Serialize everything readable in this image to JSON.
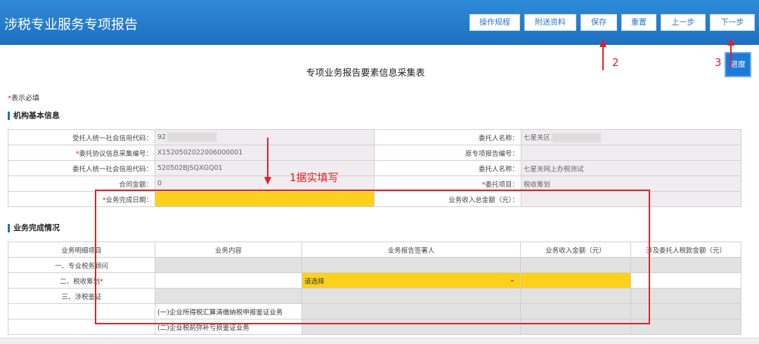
{
  "app": {
    "title": "涉税专业服务专项报告"
  },
  "toolbar": {
    "buttons": [
      "操作规程",
      "附送资料",
      "保存",
      "重置",
      "上一步",
      "下一步"
    ]
  },
  "progress_label": "进度",
  "page_title": "专项业务报告要素信息采集表",
  "required_note": {
    "star": "*",
    "text": "表示必填"
  },
  "sections": {
    "basic": "机构基本信息",
    "completion": "业务完成情况"
  },
  "basic_info": {
    "rows": [
      {
        "l1": "受托人统一社会信用代码：",
        "v1": "92",
        "l2": "委托人名称：",
        "v2": "七星关区"
      },
      {
        "l1_star": "*",
        "l1": "委托协议信息采集编号：",
        "v1": "X1520502022006000001",
        "l2": "原专项报告编号：",
        "v2": ""
      },
      {
        "l1": "委托人统一社会信用代码：",
        "v1": "520502BJSQXGQ01",
        "l2": "委托人名称：",
        "v2": "七星关网上办税测试"
      },
      {
        "l1": "合同金额：",
        "v1": "0",
        "l2_star": "*",
        "l2": "委托项目：",
        "v2": "税收筹划"
      },
      {
        "l1_star": "*",
        "l1": "业务完成日期：",
        "v1": "",
        "l2": "业务收入总金额（元）：",
        "v2": ""
      }
    ]
  },
  "completion": {
    "headers": [
      "业务明细项目",
      "业务内容",
      "业务报告签署人",
      "业务收入金额（元）",
      "涉及委托人税款金额（元）"
    ],
    "rows": [
      {
        "item": "一、专业税务顾问",
        "content": ""
      },
      {
        "item": "二、税收筹划",
        "star": "*",
        "content": "",
        "signer": "请选择"
      },
      {
        "item": "三、涉税鉴证",
        "content": ""
      },
      {
        "item": "",
        "content": "(一)企业所得税汇算清缴纳税申报鉴证业务"
      },
      {
        "item": "",
        "content": "(二)企业税前弥补亏损鉴证业务"
      }
    ]
  },
  "annotations": {
    "a1": "1据实填写",
    "a2": "2",
    "a3": "3"
  },
  "colors": {
    "header_blue": "#1e6fc0",
    "highlight_yellow": "#fcd01b",
    "annotation_red": "#e31e24"
  }
}
